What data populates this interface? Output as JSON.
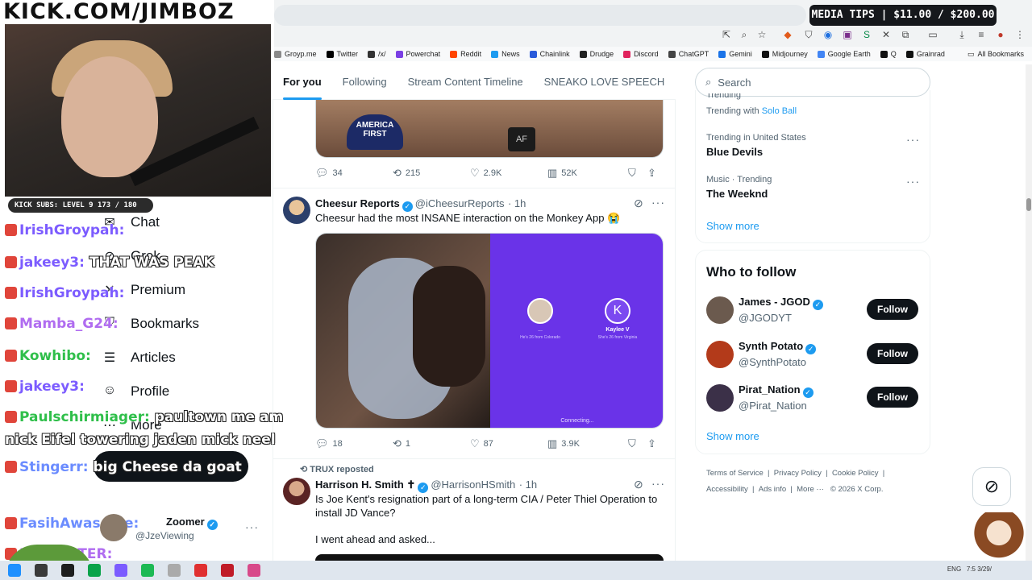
{
  "stream": {
    "channel_banner": "KICK.COM/JIMBOZ",
    "media_tips": "MEDIA TIPS | $11.00 / $200.00",
    "subs_bar": "KICK SUBS: LEVEL 9 173 / 180"
  },
  "bookmarks": [
    {
      "label": "Groyp.me",
      "color": "#8a8a8a"
    },
    {
      "label": "Twitter",
      "color": "#000000"
    },
    {
      "label": "/x/",
      "color": "#333333"
    },
    {
      "label": "Powerchat",
      "color": "#7b3fe4"
    },
    {
      "label": "Reddit",
      "color": "#ff4500"
    },
    {
      "label": "News",
      "color": "#1d9bf0"
    },
    {
      "label": "Chainlink",
      "color": "#2a5ada"
    },
    {
      "label": "Drudge",
      "color": "#222222"
    },
    {
      "label": "Discord",
      "color": "#e0245e"
    },
    {
      "label": "ChatGPT",
      "color": "#444444"
    },
    {
      "label": "Gemini",
      "color": "#1a73e8"
    },
    {
      "label": "Midjourney",
      "color": "#111111"
    },
    {
      "label": "Google Earth",
      "color": "#4285f4"
    },
    {
      "label": "Q",
      "color": "#111111"
    },
    {
      "label": "Grainrad",
      "color": "#111111"
    }
  ],
  "all_bookmarks": "All Bookmarks",
  "left_nav": [
    {
      "label": "Chat",
      "icon": "mail-icon"
    },
    {
      "label": "Grok",
      "icon": "grok-icon"
    },
    {
      "label": "Premium",
      "icon": "x-icon"
    },
    {
      "label": "Bookmarks",
      "icon": "bookmark-icon"
    },
    {
      "label": "Articles",
      "icon": "article-icon"
    },
    {
      "label": "Profile",
      "icon": "person-icon"
    },
    {
      "label": "More",
      "icon": "more-icon"
    }
  ],
  "chat": [
    {
      "user": "IrishGroypah:",
      "color": "#7c5cff",
      "msg": ""
    },
    {
      "user": "jakeey3:",
      "color": "#7c5cff",
      "msg": "THAT WAS PEAK"
    },
    {
      "user": "IrishGroypah:",
      "color": "#7c5cff",
      "msg": ""
    },
    {
      "user": "Mamba_G24:",
      "color": "#b06cf0",
      "msg": ""
    },
    {
      "user": "Kowhibo:",
      "color": "#2fbf4a",
      "msg": ""
    },
    {
      "user": "jakeey3:",
      "color": "#7c5cff",
      "msg": ""
    },
    {
      "user": "Paulschirmiager:",
      "color": "#2fbf4a",
      "msg": "paultown me am"
    },
    {
      "user": "",
      "color": "#ffffff",
      "msg": "nick Eifel towering jaden mick neel"
    },
    {
      "user": "Stingerr:",
      "color": "#6b8cff",
      "msg": "big Cheese da goat"
    },
    {
      "user": "FasihAwasome:",
      "color": "#6b8cff",
      "msg": ""
    },
    {
      "user": "No1_HATER:",
      "color": "#b06cf0",
      "msg": ""
    }
  ],
  "account": {
    "name": "Zoomer",
    "handle": "@JzeViewing"
  },
  "tabs": [
    "For you",
    "Following",
    "Stream Content Timeline",
    "SNEAKO LOVE SPEECH"
  ],
  "tweets": [
    {
      "stats": {
        "replies": "34",
        "reposts": "215",
        "likes": "2.9K",
        "views": "52K"
      },
      "image_caption": "AMERICA FIRST"
    },
    {
      "name": "Cheesur Reports",
      "handle": "@iCheesurReports",
      "time": "· 1h",
      "text": "Cheesur had the most INSANE interaction on the Monkey App 😭",
      "stats": {
        "replies": "18",
        "reposts": "1",
        "likes": "87",
        "views": "3.9K"
      },
      "video": {
        "left_name": "...",
        "left_sub": "He's 26 from Colorado",
        "right_initial": "K",
        "right_name": "Kaylee V",
        "right_sub": "She's 26 from Virginia",
        "status": "Connecting..."
      }
    },
    {
      "repost_by": "TRUX reposted",
      "name": "Harrison H. Smith ✝",
      "handle": "@HarrisonHSmith",
      "time": "· 1h",
      "text": "Is Joe Kent's resignation part of a long-term CIA / Peter Thiel Operation to install JD Vance?",
      "text2": "I went ahead and asked..."
    }
  ],
  "search": {
    "placeholder": "Search"
  },
  "trends": {
    "top_partial": "Trending",
    "top_trending_with": "Trending with",
    "top_link": "Solo Ball",
    "items": [
      {
        "meta": "Trending in United States",
        "title": "Blue Devils"
      },
      {
        "meta": "Music · Trending",
        "title": "The Weeknd"
      }
    ],
    "show_more": "Show more"
  },
  "who_to_follow": {
    "title": "Who to follow",
    "users": [
      {
        "name": "James - JGOD",
        "handle": "@JGODYT",
        "button": "Follow",
        "avatar": "#6b5a4e"
      },
      {
        "name": "Synth Potato",
        "handle": "@SynthPotato",
        "button": "Follow",
        "avatar": "#b33a1a"
      },
      {
        "name": "Pirat_Nation",
        "handle": "@Pirat_Nation",
        "button": "Follow",
        "avatar": "#3b3048"
      }
    ],
    "show_more": "Show more"
  },
  "footer": {
    "row1": [
      "Terms of Service",
      "Privacy Policy",
      "Cookie Policy"
    ],
    "row2": [
      "Accessibility",
      "Ads info",
      "More ···",
      "© 2026 X Corp."
    ]
  },
  "taskbar": {
    "lang": "ENG",
    "time": "7:5",
    "date": "3/29/",
    "icons": [
      "#1e90ff",
      "#3a3a3a",
      "#1e1e1e",
      "#0aa34a",
      "#7b5cff",
      "#1db954",
      "#aaaaaa",
      "#e03030",
      "#c01c28",
      "#d84a8a"
    ]
  }
}
